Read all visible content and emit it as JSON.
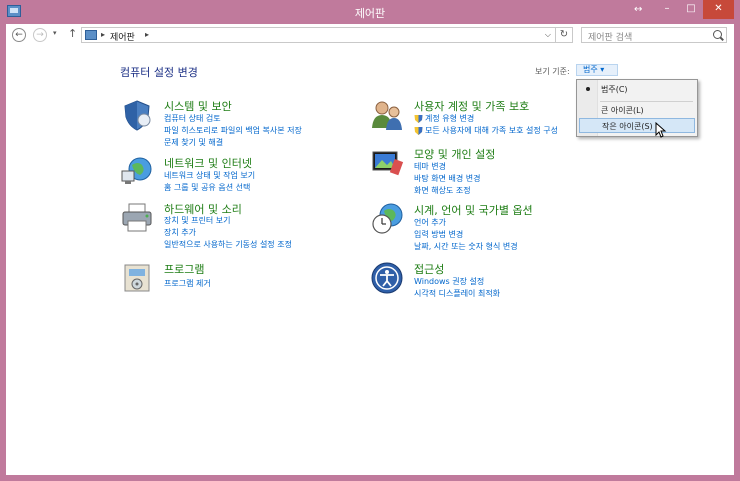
{
  "window": {
    "title": "제어판",
    "resize_glyph": "↔",
    "minimize": "–",
    "maximize": "□",
    "close": "✕"
  },
  "nav": {
    "back": "←",
    "forward": "→",
    "dropdown": "▾",
    "up": "↑",
    "refresh": "↻"
  },
  "address": {
    "sep": "▸",
    "crumb": "제어판",
    "dropdown": "⌵"
  },
  "search": {
    "placeholder": "제어판 검색"
  },
  "heading": "컴퓨터 설정 변경",
  "viewby": {
    "label": "보기 기준:",
    "value": "범주 ▾"
  },
  "categories": {
    "system": {
      "title": "시스템 및 보안",
      "links": [
        "컴퓨터 상태 검토",
        "파일 히스토리로 파일의 백업 복사본 저장",
        "문제 찾기 및 해결"
      ]
    },
    "network": {
      "title": "네트워크 및 인터넷",
      "links": [
        "네트워크 상태 및 작업 보기",
        "홈 그룹 및 공유 옵션 선택"
      ]
    },
    "hardware": {
      "title": "하드웨어 및 소리",
      "links": [
        "장치 및 프린터 보기",
        "장치 추가",
        "일반적으로 사용하는 기동성 설정 조정"
      ]
    },
    "programs": {
      "title": "프로그램",
      "links": [
        "프로그램 제거"
      ]
    },
    "users": {
      "title": "사용자 계정 및 가족 보호",
      "links": [
        "계정 유형 변경",
        "모든 사용자에 대해 가족 보호 설정 구성"
      ]
    },
    "appearance": {
      "title": "모양 및 개인 설정",
      "links": [
        "테마 변경",
        "바탕 화면 배경 변경",
        "화면 해상도 조정"
      ]
    },
    "clock": {
      "title": "시계, 언어 및 국가별 옵션",
      "links": [
        "언어 추가",
        "입력 방법 변경",
        "날짜, 시간 또는 숫자 형식 변경"
      ]
    },
    "ease": {
      "title": "접근성",
      "links": [
        "Windows 권장 설정",
        "시각적 디스플레이 최적화"
      ]
    }
  },
  "menu": {
    "items": [
      "범주(C)",
      "큰 아이콘(L)",
      "작은 아이콘(S)"
    ],
    "checked_index": 0,
    "hover_index": 2
  },
  "colors": {
    "title_bar": "#c07a9c",
    "category_title": "#1e7d14",
    "link": "#0066cc",
    "heading": "#1e3287"
  }
}
